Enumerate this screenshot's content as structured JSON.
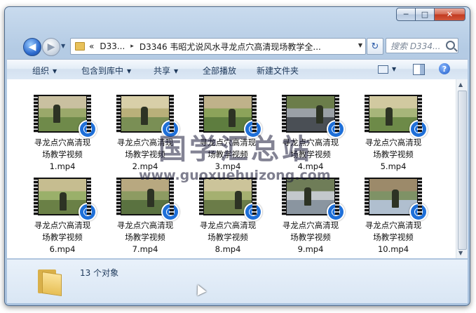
{
  "window": {
    "min_glyph": "─",
    "max_glyph": "□",
    "close_glyph": "✕"
  },
  "nav": {
    "back_glyph": "◀",
    "forward_glyph": "▶",
    "address": {
      "chevron": "«",
      "segments": [
        "D33...",
        "D3346 韦昭尤说风水寻龙点穴高清现场教学全..."
      ],
      "separator": "▸"
    },
    "refresh_glyph": "↻",
    "search_placeholder": "搜索 D334..."
  },
  "toolbar": {
    "organize": "组织",
    "include_in_library": "包含到库中",
    "share": "共享",
    "play_all": "全部播放",
    "new_folder": "新建文件夹",
    "help_glyph": "?"
  },
  "files": [
    {
      "line1": "寻龙点穴高清现",
      "line2": "场教学视频",
      "line3": "1.mp4"
    },
    {
      "line1": "寻龙点穴高清现",
      "line2": "场教学视频",
      "line3": "2.mp4"
    },
    {
      "line1": "寻龙点穴高清现",
      "line2": "场教学视频",
      "line3": "3.mp4"
    },
    {
      "line1": "寻龙点穴高清现",
      "line2": "场教学视频",
      "line3": "4.mp4"
    },
    {
      "line1": "寻龙点穴高清现",
      "line2": "场教学视频",
      "line3": "5.mp4"
    },
    {
      "line1": "寻龙点穴高清现",
      "line2": "场教学视频",
      "line3": "6.mp4"
    },
    {
      "line1": "寻龙点穴高清现",
      "line2": "场教学视频",
      "line3": "7.mp4"
    },
    {
      "line1": "寻龙点穴高清现",
      "line2": "场教学视频",
      "line3": "8.mp4"
    },
    {
      "line1": "寻龙点穴高清现",
      "line2": "场教学视频",
      "line3": "9.mp4"
    },
    {
      "line1": "寻龙点穴高清现",
      "line2": "场教学视频",
      "line3": "10.mp4"
    }
  ],
  "status": {
    "count": "13 个对象"
  },
  "watermark": {
    "title": "国学汇总站",
    "url": "www.guoxuehuizong.com"
  },
  "colors": {
    "accent": "#1e6fd8",
    "window_frame": "#b4cbe4",
    "close_red": "#c2391f"
  }
}
